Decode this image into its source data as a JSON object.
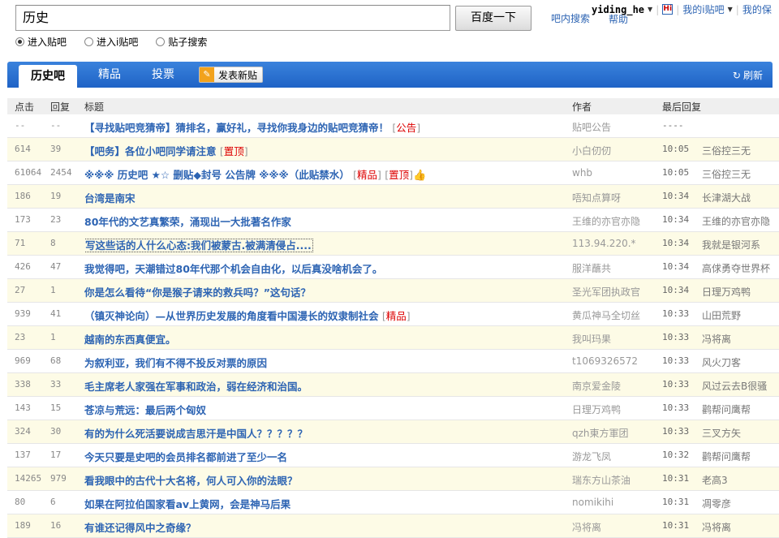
{
  "search": {
    "value": "历史",
    "button_label": "百度一下",
    "options": [
      {
        "label": "进入贴吧",
        "selected": true
      },
      {
        "label": "进入i贴吧",
        "selected": false
      },
      {
        "label": "贴子搜索",
        "selected": false
      }
    ],
    "inbar_search": "吧内搜索"
  },
  "user": {
    "name": "yiding_he",
    "help": "帮助",
    "my_ibar": "我的i贴吧",
    "my_more": "我的保"
  },
  "nav": {
    "tabs": [
      {
        "label": "历史吧",
        "active": true
      },
      {
        "label": "精品",
        "active": false
      },
      {
        "label": "投票",
        "active": false
      }
    ],
    "post_button": "发表新贴",
    "refresh": "刷新"
  },
  "table": {
    "headers": {
      "clicks": "点击",
      "replies": "回复",
      "title": "标题",
      "author": "作者",
      "last_reply": "最后回复"
    },
    "rows": [
      {
        "clicks": "--",
        "replies": "--",
        "title": "【寻找贴吧竞猜帝】猜排名，赢好礼，寻找你我身边的贴吧竞猜帝！",
        "tags": [
          "公告"
        ],
        "author": "贴吧公告",
        "time": "----",
        "last": ""
      },
      {
        "clicks": "614",
        "replies": "39",
        "title": "【吧务】各位小吧同学请注意",
        "tags": [
          "置顶"
        ],
        "author": "小白仞仞",
        "time": "10:05",
        "last": "三俗控三无"
      },
      {
        "clicks": "61064",
        "replies": "2454",
        "title": "※※※ 历史吧 ★☆ 删贴◆封号 公告牌 ※※※（此贴禁水）",
        "tags": [
          "精品",
          "置顶"
        ],
        "thumb": true,
        "author": "whb",
        "time": "10:05",
        "last": "三俗控三无"
      },
      {
        "clicks": "186",
        "replies": "19",
        "title": "台湾是南宋",
        "tags": [],
        "author": "唔知点算呀",
        "time": "10:34",
        "last": "长津湖大战"
      },
      {
        "clicks": "173",
        "replies": "23",
        "title": "80年代的文艺真繁荣，涌现出一大批著名作家",
        "tags": [],
        "author": "王维的亦官亦隐",
        "time": "10:34",
        "last": "王维的亦官亦隐"
      },
      {
        "clicks": "71",
        "replies": "8",
        "title": "写这些话的人什么心态:我们被蒙古.被满清侵占....",
        "tags": [],
        "boxed": true,
        "author": "113.94.220.*",
        "time": "10:34",
        "last": "我就是银河系"
      },
      {
        "clicks": "426",
        "replies": "47",
        "title": "我觉得吧，天潮错过80年代那个机会自由化，以后真没啥机会了。",
        "tags": [],
        "author": "服洋蘸共",
        "time": "10:34",
        "last": "高俅勇夺世界杯"
      },
      {
        "clicks": "27",
        "replies": "1",
        "title": "你是怎么看待“你是猴子请来的救兵吗？”这句话？",
        "tags": [],
        "author": "圣光军团执政官",
        "time": "10:34",
        "last": "日理万鸡鸭"
      },
      {
        "clicks": "939",
        "replies": "41",
        "title": "（镇灭神论向）—从世界历史发展的角度看中国漫长的奴隶制社会",
        "tags": [
          "精品"
        ],
        "author": "黄瓜神马全切丝",
        "time": "10:33",
        "last": "山田荒野"
      },
      {
        "clicks": "23",
        "replies": "1",
        "title": "越南的东西真便宜。",
        "tags": [],
        "author": "我叫玛果",
        "time": "10:33",
        "last": "冯将离"
      },
      {
        "clicks": "969",
        "replies": "68",
        "title": "为叙利亚，我们有不得不投反对票的原因",
        "tags": [],
        "author": "t1069326572",
        "time": "10:33",
        "last": "风火刀客"
      },
      {
        "clicks": "338",
        "replies": "33",
        "title": "毛主席老人家强在军事和政治，弱在经济和治国。",
        "tags": [],
        "author": "南京爱金陵",
        "time": "10:33",
        "last": "风过云去B很骚"
      },
      {
        "clicks": "143",
        "replies": "15",
        "title": "苍凉与荒远：最后两个匈奴",
        "tags": [],
        "author": "日理万鸡鸭",
        "time": "10:33",
        "last": "鹳帮问鹰帮"
      },
      {
        "clicks": "324",
        "replies": "30",
        "title": "有的为什么死活要说成吉思汗是中国人？？？？？",
        "tags": [],
        "author": "qzh東方軍团",
        "time": "10:33",
        "last": "三叉方矢"
      },
      {
        "clicks": "137",
        "replies": "17",
        "title": "今天只要是史吧的会员排名都前进了至少一名",
        "tags": [],
        "author": "游龙飞凤",
        "time": "10:32",
        "last": "鹳帮问鹰帮"
      },
      {
        "clicks": "14265",
        "replies": "979",
        "title": "看我眼中的古代十大名将，何人可入你的法眼？",
        "tags": [],
        "author": "瑞东方山茶油",
        "time": "10:31",
        "last": "老高3"
      },
      {
        "clicks": "80",
        "replies": "6",
        "title": "如果在阿拉伯国家看av上黄网，会是神马后果",
        "tags": [],
        "author": "nomikihi",
        "time": "10:31",
        "last": "凋零彦"
      },
      {
        "clicks": "189",
        "replies": "16",
        "title": "有谁还记得风中之奇缘？",
        "tags": [],
        "author": "冯将离",
        "time": "10:31",
        "last": "冯将离"
      }
    ]
  }
}
